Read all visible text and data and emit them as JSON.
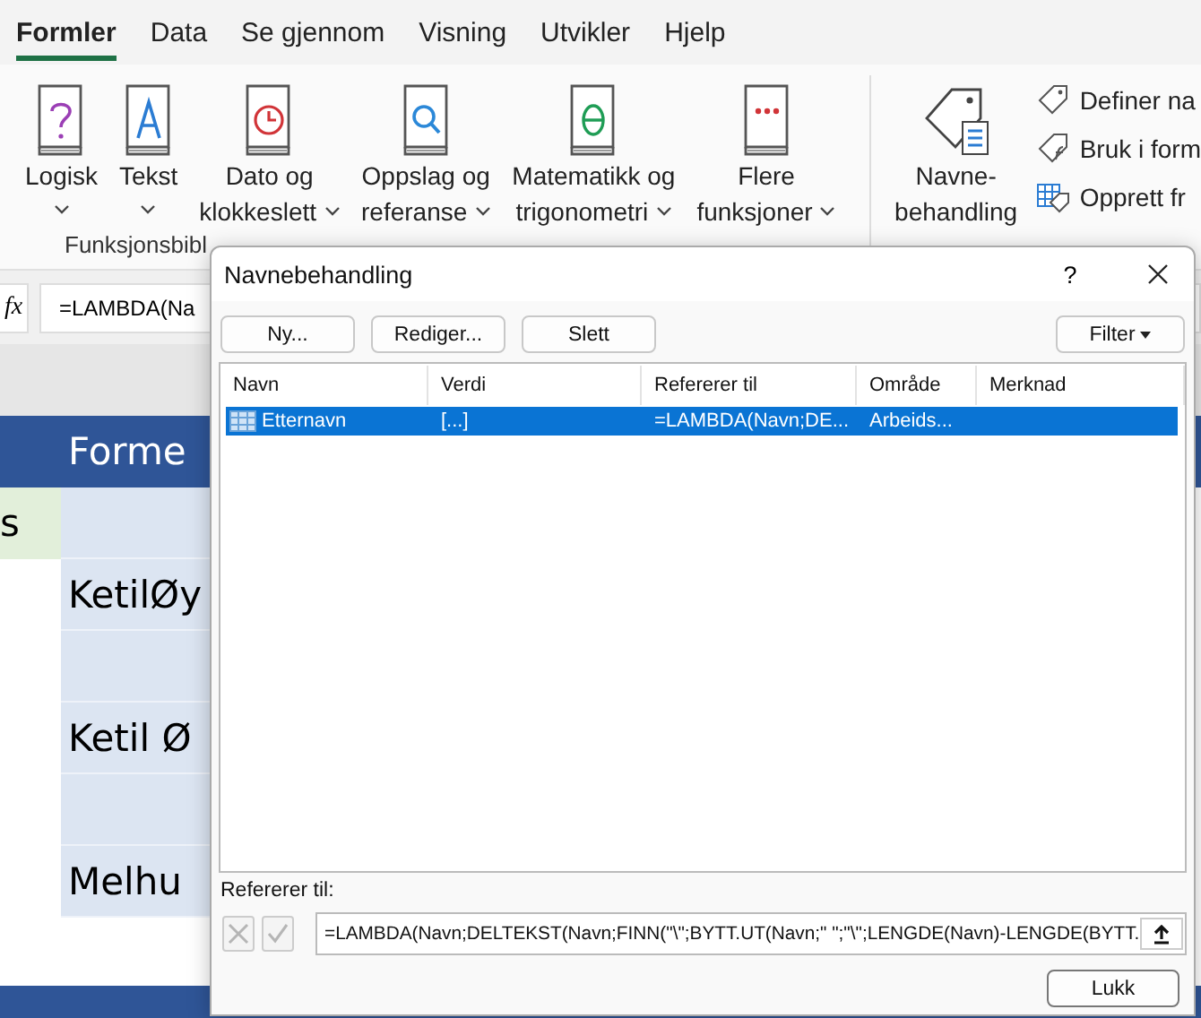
{
  "tabs": [
    {
      "label": "Formler",
      "selected": true
    },
    {
      "label": "Data",
      "selected": false
    },
    {
      "label": "Se gjennom",
      "selected": false
    },
    {
      "label": "Visning",
      "selected": false
    },
    {
      "label": "Utvikler",
      "selected": false
    },
    {
      "label": "Hjelp",
      "selected": false
    }
  ],
  "ribbon": {
    "function_buttons": [
      {
        "kind": "question",
        "lines": [
          "Logisk"
        ],
        "dropdown": true
      },
      {
        "kind": "letter",
        "lines": [
          "Tekst"
        ],
        "dropdown": true
      },
      {
        "kind": "clock",
        "lines": [
          "Dato og",
          "klokkeslett"
        ],
        "dropdown": true
      },
      {
        "kind": "magnifier",
        "lines": [
          "Oppslag og",
          "referanse"
        ],
        "dropdown": true
      },
      {
        "kind": "theta",
        "lines": [
          "Matematikk og",
          "trigonometri"
        ],
        "dropdown": true
      },
      {
        "kind": "dots",
        "lines": [
          "Flere",
          "funksjoner"
        ],
        "dropdown": true
      }
    ],
    "group_label": "Funksjonsbibl",
    "name_manager": {
      "lines": [
        "Navne-",
        "behandling"
      ]
    },
    "small_buttons": [
      {
        "kind": "tag",
        "label": "Definer na"
      },
      {
        "kind": "tag-fx",
        "label": "Bruk i form"
      },
      {
        "kind": "table-tag",
        "label": "Opprett fr"
      }
    ]
  },
  "formula_bar": {
    "fx": "fx",
    "value": "=LAMBDA(Na"
  },
  "sheet": {
    "header": "Forme",
    "rows": [
      {
        "kind": "label",
        "column_1": "s"
      },
      {
        "kind": "text",
        "column_2": "KetilØy"
      },
      {
        "kind": "blank"
      },
      {
        "kind": "text",
        "column_2": "Ketil Ø"
      },
      {
        "kind": "blank"
      },
      {
        "kind": "text",
        "column_2": "Melhu"
      }
    ]
  },
  "dialog": {
    "title": "Navnebehandling",
    "help": "?",
    "buttons": [
      "Ny...",
      "Rediger...",
      "Slett"
    ],
    "filter": "Filter",
    "columns": [
      "Navn",
      "Verdi",
      "Refererer til",
      "Område",
      "Merknad"
    ],
    "rows": [
      {
        "cells": [
          "Etternavn",
          "[...]",
          "=LAMBDA(Navn;DE...",
          "Arbeids..."
        ],
        "selected": true
      }
    ],
    "reference": {
      "label": "Refererer til:",
      "value": "=LAMBDA(Navn;DELTEKST(Navn;FINN(\"\\\";BYTT.UT(Navn;\" \";\"\\\";LENGDE(Navn)-LENGDE(BYTT.",
      "cancel": {
        "disabled": true
      },
      "confirm": {
        "disabled": true
      }
    },
    "close_button": "Lukk"
  }
}
